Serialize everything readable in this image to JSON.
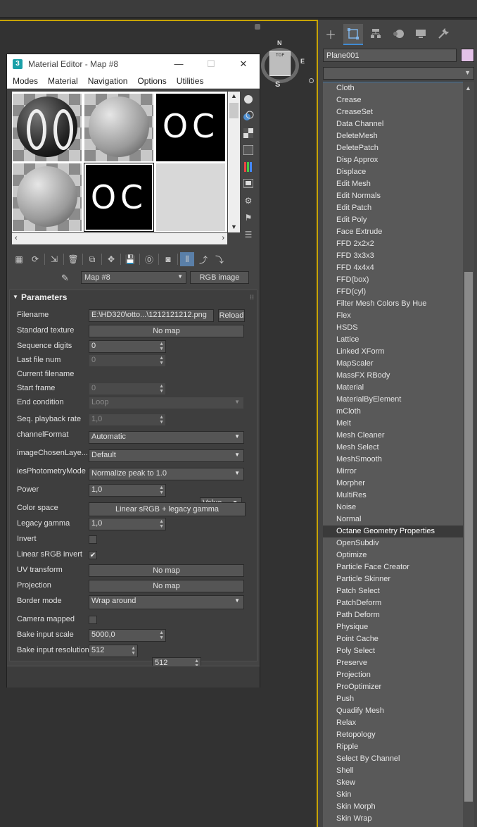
{
  "material_editor": {
    "title": "Material Editor - Map #8",
    "app_logo": "3",
    "window_buttons": {
      "minimize": "—",
      "maximize": "☐",
      "close": "✕"
    },
    "menu": [
      "Modes",
      "Material",
      "Navigation",
      "Options",
      "Utilities"
    ],
    "slot_text": "OC",
    "map_name": "Map #8",
    "map_type": "RGB image",
    "rollout_title": "Parameters",
    "params": {
      "filename": {
        "label": "Filename",
        "value": "E:\\HD320\\otto...\\1212121212.png",
        "button": "Reload"
      },
      "standard_texture": {
        "label": "Standard texture",
        "value": "No map"
      },
      "sequence_digits": {
        "label": "Sequence digits",
        "value": "0"
      },
      "last_file_num": {
        "label": "Last file num",
        "value": "0"
      },
      "current_filename": {
        "label": "Current filename"
      },
      "start_frame": {
        "label": "Start frame",
        "value": "0"
      },
      "end_condition": {
        "label": "End condition",
        "value": "Loop"
      },
      "seq_playback_rate": {
        "label": "Seq. playback rate",
        "value": "1,0"
      },
      "channel_format": {
        "label": "channelFormat",
        "value": "Automatic"
      },
      "image_chosen_layer": {
        "label": "imageChosenLaye...",
        "value": "Default"
      },
      "ies_photometry_mode": {
        "label": "iesPhotometryMode",
        "value": "Normalize peak to 1.0"
      },
      "power": {
        "label": "Power",
        "value": "1,0",
        "mode": "Value"
      },
      "color_space": {
        "label": "Color space",
        "value": "Linear sRGB + legacy gamma"
      },
      "legacy_gamma": {
        "label": "Legacy gamma",
        "value": "1,0"
      },
      "invert": {
        "label": "Invert",
        "checked": false
      },
      "linear_srgb_invert": {
        "label": "Linear sRGB invert",
        "checked": true
      },
      "uv_transform": {
        "label": "UV transform",
        "value": "No map"
      },
      "projection": {
        "label": "Projection",
        "value": "No map"
      },
      "border_mode": {
        "label": "Border mode",
        "value": "Wrap around"
      },
      "camera_mapped": {
        "label": "Camera mapped",
        "checked": false
      },
      "bake_input_scale": {
        "label": "Bake input scale",
        "value": "5000,0"
      },
      "bake_input_resolution": {
        "label": "Bake input resolution",
        "value_x": "512",
        "value_y": "512"
      }
    }
  },
  "viewcube": {
    "top": "TOP",
    "n": "N",
    "s": "S",
    "e": "E"
  },
  "command_panel": {
    "object_name": "Plane001",
    "object_color": "#e4c2e8",
    "modifier_list": [
      "Cloth",
      "Crease",
      "CreaseSet",
      "Data Channel",
      "DeleteMesh",
      "DeletePatch",
      "Disp Approx",
      "Displace",
      "Edit Mesh",
      "Edit Normals",
      "Edit Patch",
      "Edit Poly",
      "Face Extrude",
      "FFD 2x2x2",
      "FFD 3x3x3",
      "FFD 4x4x4",
      "FFD(box)",
      "FFD(cyl)",
      "Filter Mesh Colors By Hue",
      "Flex",
      "HSDS",
      "Lattice",
      "Linked XForm",
      "MapScaler",
      "MassFX RBody",
      "Material",
      "MaterialByElement",
      "mCloth",
      "Melt",
      "Mesh Cleaner",
      "Mesh Select",
      "MeshSmooth",
      "Mirror",
      "Morpher",
      "MultiRes",
      "Noise",
      "Normal",
      "Octane Geometry Properties",
      "OpenSubdiv",
      "Optimize",
      "Particle Face Creator",
      "Particle Skinner",
      "Patch Select",
      "PatchDeform",
      "Path Deform",
      "Physique",
      "Point Cache",
      "Poly Select",
      "Preserve",
      "Projection",
      "ProOptimizer",
      "Push",
      "Quadify Mesh",
      "Relax",
      "Retopology",
      "Ripple",
      "Select By Channel",
      "Shell",
      "Skew",
      "Skin",
      "Skin Morph",
      "Skin Wrap"
    ],
    "selected_modifier": "Octane Geometry Properties"
  }
}
